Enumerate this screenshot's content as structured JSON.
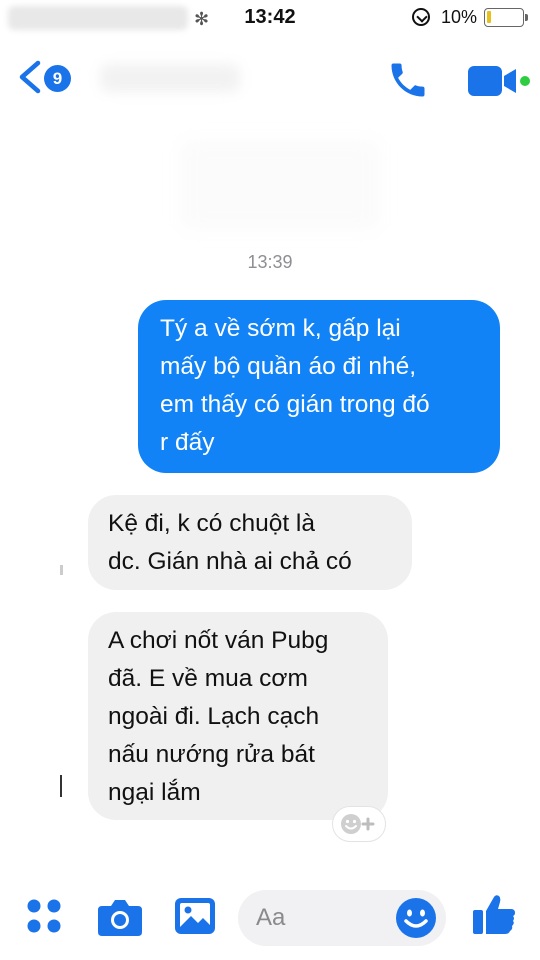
{
  "status_bar": {
    "time": "13:42",
    "battery": "10%"
  },
  "nav": {
    "unread_count": "9"
  },
  "conversation": {
    "timestamp": "13:39",
    "messages": [
      {
        "sender": "me",
        "text": "Tý a về sớm k, gấp lại\nmấy bộ quần áo đi nhé,\nem thấy có gián trong đó\nr đấy"
      },
      {
        "sender": "them",
        "text": "Kệ đi, k có chuột là\ndc. Gián nhà ai chả có"
      },
      {
        "sender": "them",
        "text": "A chơi nốt ván Pubg\nđã. E về mua cơm\nngoài đi. Lạch cạch\nnấu nướng rửa bát\nngại lắm"
      }
    ]
  },
  "composer": {
    "placeholder": "Aa"
  },
  "colors": {
    "accent": "#1283f6",
    "incoming_bubble": "#f0f0f0",
    "timestamp": "#8e8e93"
  },
  "icons": [
    "back-chevron-icon",
    "phone-icon",
    "video-camera-icon",
    "apps-grid-icon",
    "camera-icon",
    "gallery-icon",
    "emoji-icon",
    "thumbs-up-icon",
    "add-reaction-icon"
  ]
}
